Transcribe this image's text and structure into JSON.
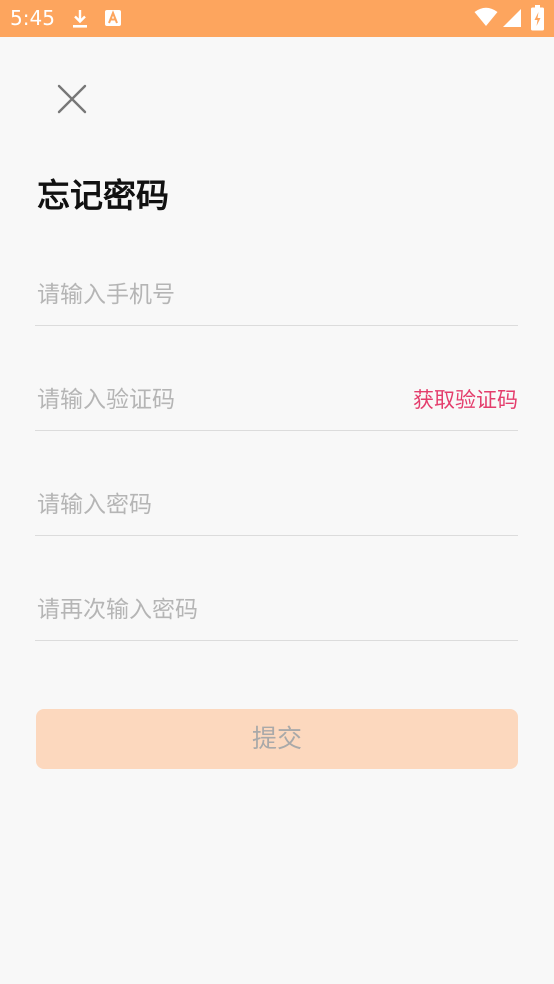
{
  "status_bar": {
    "time": "5:45",
    "icons": [
      "download-icon",
      "a-icon",
      "wifi-icon",
      "signal-icon",
      "battery-icon"
    ],
    "background": "#fda55e"
  },
  "header": {
    "close_icon": "close-icon",
    "title": "忘记密码"
  },
  "form": {
    "phone_placeholder": "请输入手机号",
    "code_placeholder": "请输入验证码",
    "get_code_label": "获取验证码",
    "password_placeholder": "请输入密码",
    "confirm_password_placeholder": "请再次输入密码",
    "submit_label": "提交"
  },
  "colors": {
    "accent": "#e43d6c",
    "submit_bg": "#fcd8be",
    "page_bg": "#f8f8f8"
  }
}
